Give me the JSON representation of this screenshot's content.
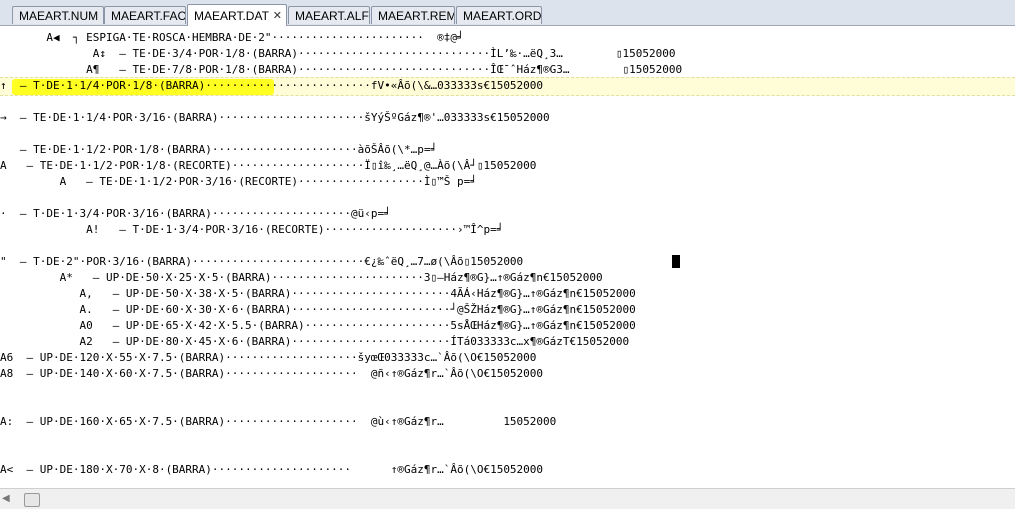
{
  "tabs": [
    {
      "label": "MAEART.NUM",
      "active": false
    },
    {
      "label": "MAEART.FAC",
      "active": false
    },
    {
      "label": "MAEART.DAT",
      "active": true
    },
    {
      "label": "MAEART.ALF",
      "active": false
    },
    {
      "label": "MAEART.REM",
      "active": false
    },
    {
      "label": "MAEART.ORD",
      "active": false
    }
  ],
  "close_glyph": "✕",
  "editor": {
    "lines": [
      "       A◀  ┐ ESPIGA·TE·ROSCA·HEMBRA·DE·2\"·······················  ®‡@╛",
      "              A↕  – TE·DE·3/4·POR·1/8·(BARRA)·····························ÌL’‰·…ëQ¸3…        ▯15052000",
      "             A¶   – TE·DE·7/8·POR·1/8·(BARRA)·····························ÎŒ¯ˆHáz¶®G3…        ▯15052000",
      "↑  – T·DE·1·1/4·POR·1/8·(BARRA)·························fV•«Âõ(\\&…033333s€15052000",
      "",
      "→  – TE·DE·1·1/4·POR·3/16·(BARRA)······················šYýŠºGáz¶®'…033333s€15052000",
      "",
      "   – TE·DE·1·1/2·POR·1/8·(BARRA)······················àõŠÂõ(\\*…p=╛",
      "A   – TE·DE·1·1/2·POR·1/8·(RECORTE)····················Ï▯î‰¸…ëQ¸@…Àõ(\\Â┘▯15052000",
      "         A   – TE·DE·1·1/2·POR·3/16·(RECORTE)···················Ì▯™Š p=╛",
      "",
      "·  – T·DE·1·3/4·POR·3/16·(BARRA)·····················@ü‹p=╛",
      "             A!   – T·DE·1·3/4·POR·3/16·(RECORTE)····················›™Î^p=╛",
      "",
      "\"  – T·DE·2\"·POR·3/16·(BARRA)··························€¿‰ˆëQ¸…7…ø(\\Âõ▯15052000",
      "         A*   – UP·DE·50·X·25·X·5·(BARRA)·······················3▯—Ház¶®G}…↑®Gáz¶n€15052000",
      "            A,   – UP·DE·50·X·38·X·5·(BARRA)························4ÃÁ‹Ház¶®G}…↑®Gáz¶n€15052000",
      "            A.   – UP·DE·60·X·30·X·6·(BARRA)························┘@ŠŽHáz¶®G}…↑®Gáz¶n€15052000",
      "            A0   – UP·DE·65·X·42·X·5.5·(BARRA)······················5sÅŒHáz¶®G}…↑®Gáz¶n€15052000",
      "            A2   – UP·DE·80·X·45·X·6·(BARRA)························ÍTá033333c…x¶®GázT€15052000",
      "A6  – UP·DE·120·X·55·X·7.5·(BARRA)····················šyœŒ033333c…`Âõ(\\O€15052000",
      "A8  – UP·DE·140·X·60·X·7.5·(BARRA)····················  @ñ‹↑®Gáz¶r…`Âõ(\\O€15052000",
      "",
      "",
      "A:  – UP·DE·160·X·65·X·7.5·(BARRA)····················  @ù‹↑®Gáz¶r…         15052000",
      "",
      "",
      "A<  – UP·DE·180·X·70·X·8·(BARRA)·····················      ↑®Gáz¶r…`Âõ(\\O€15052000"
    ]
  },
  "scrollbar": {
    "left_arrow": "◀"
  }
}
